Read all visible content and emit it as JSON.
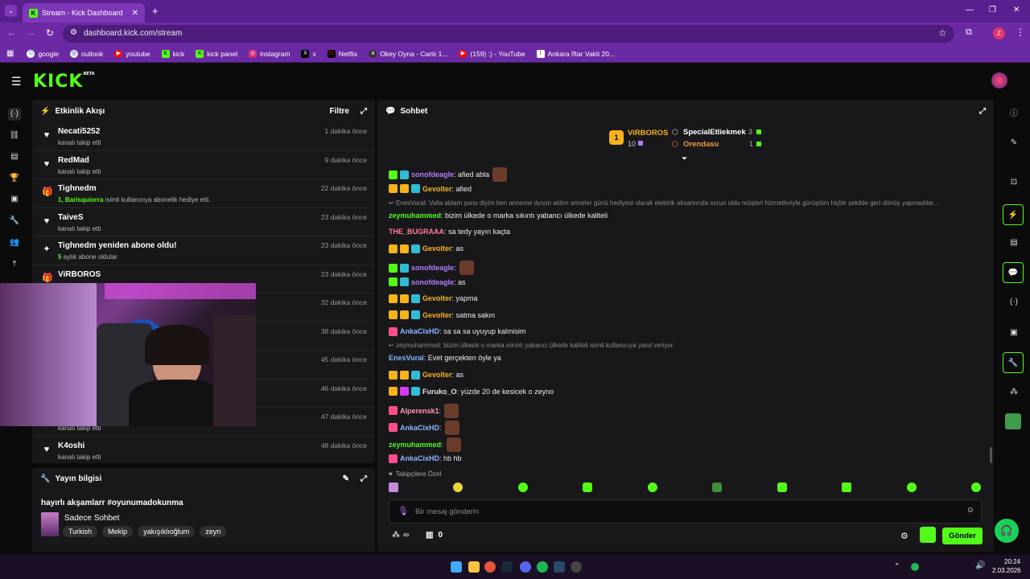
{
  "browser": {
    "tab_title": "Stream - Kick Dashboard",
    "url": "dashboard.kick.com/stream",
    "profile_initial": "Z",
    "bookmarks": [
      "google",
      "outlook",
      "youtube",
      "kick",
      "kick panel",
      "instagram",
      "x",
      "Netflix",
      "Okey Oyna - Canlı 1...",
      "(159) :) - YouTube",
      "Ankara İftar Vakti 20..."
    ]
  },
  "app": {
    "logo": "KICK",
    "logo_badge": "BETA"
  },
  "activity": {
    "title": "Etkinlik Akışı",
    "filter_label": "Filtre",
    "events": [
      {
        "name": "Necati5252",
        "time": "1 dakika önce",
        "sub": "kanalı takip etti",
        "icon": "heart"
      },
      {
        "name": "RedMad",
        "time": "9 dakika önce",
        "sub": "kanalı takip etti",
        "icon": "heart"
      },
      {
        "name": "Tighnedm",
        "time": "22 dakika önce",
        "sub_strong": "1, Barisquiorra",
        "sub": " isimli kullanıcıya abonelik hediye etti.",
        "icon": "gift"
      },
      {
        "name": "TaiveS",
        "time": "23 dakika önce",
        "sub": "kanalı takip etti",
        "icon": "heart"
      },
      {
        "name": "Tighnedm yeniden abone oldu!",
        "time": "23 dakika önce",
        "sub_strong": "5",
        "sub": " aylık abone oldular",
        "icon": "sparkle"
      },
      {
        "name": "ViRBOROS",
        "time": "23 dakika önce",
        "sub": "kullanıcıya abonelik hediye etti.",
        "icon": "gift"
      },
      {
        "name": "",
        "time": "32 dakika önce",
        "sub": "",
        "icon": "heart"
      },
      {
        "name": "",
        "time": "38 dakika önce",
        "sub": "onelik hediye etti.",
        "icon": "gift"
      },
      {
        "name": "",
        "time": "45 dakika önce",
        "sub": "",
        "icon": "heart"
      },
      {
        "name": "",
        "time": "46 dakika önce",
        "sub": "",
        "icon": "heart"
      },
      {
        "name": "",
        "time": "47 dakika önce",
        "sub": "kanalı takip etti",
        "icon": "heart"
      },
      {
        "name": "K4oshi",
        "time": "48 dakika önce",
        "sub": "kanalı takip etti",
        "icon": "heart"
      }
    ]
  },
  "stream_info": {
    "title": "Yayın bilgisi",
    "stream_title": "hayırlı akşamlarr #oyunumadokunma",
    "category": "Sadece Sohbet",
    "tags": [
      "Turkish",
      "Mekip",
      "yakışıklıoğlum",
      "zeyn"
    ]
  },
  "chat": {
    "title": "Sohbet",
    "leaderboard": {
      "first": {
        "name": "ViRBOROS",
        "rank": "1",
        "count": "10"
      },
      "second": {
        "name": "SpecialEtliekmek",
        "count": "3"
      },
      "third": {
        "name": "Orendasu",
        "count": "1"
      }
    },
    "messages": [
      {
        "user": "sonofdeagle",
        "color": "#b37bff",
        "text": ": afied abla",
        "emote": true
      },
      {
        "user": "Gevolter",
        "color": "#f5b21a",
        "text": ": afied"
      },
      {
        "reply": "EnesVural: Valla ablam şunu diyim ben anneme dyson aldım anneler günü hediyesi olarak elektrik aksamında sorun oldu müşteri hizmetleriyle görüştüm hiçbir şekilde geri dönüş yapmadılar..."
      },
      {
        "user": "zeymuhammed",
        "color": "#53fc18",
        "text": ": bizim ülkede o marka sıkıntı yabancı ülkede kaliteli"
      },
      {
        "user": "THE_BUGRAAA",
        "color": "#ff7a9a",
        "text": ": sa tedy yayın kaçta"
      },
      {
        "user": "Gevolter",
        "color": "#f5b21a",
        "text": ": as"
      },
      {
        "user": "sonofdeagle",
        "color": "#b37bff",
        "text": ": ",
        "emote": true
      },
      {
        "user": "sonofdeagle",
        "color": "#b37bff",
        "text": ": as"
      },
      {
        "user": "Gevolter",
        "color": "#f5b21a",
        "text": ": yapma"
      },
      {
        "user": "Gevolter",
        "color": "#f5b21a",
        "text": ": satma sakın"
      },
      {
        "user": "AnkaCixHD",
        "color": "#8ab4ff",
        "text": ": sa sa sa uyuyup kalmisim"
      },
      {
        "reply": "zeymuhammed: bizim ülkede o marka sıkıntı yabancı ülkede kaliteli isimli kullanıcıya yanıt veriyor"
      },
      {
        "user": "EnesVural",
        "color": "#7ab8ff",
        "text": ": Evet gerçekten öyle ya"
      },
      {
        "user": "Gevolter",
        "color": "#f5b21a",
        "text": ": as"
      },
      {
        "user": "Furuko_O",
        "color": "#e0e0e0",
        "text": ": yüzde 20 de kesicek o zeyno"
      },
      {
        "user": "Alperensk1",
        "color": "#ff9aa8",
        "text": ": ",
        "emote": true
      },
      {
        "user": "AnkaCixHD",
        "color": "#8ab4ff",
        "text": ": ",
        "emote": true
      },
      {
        "user": "zeymuhammed",
        "color": "#53fc18",
        "text": ": ",
        "emote": true
      },
      {
        "user": "AnkaCixHD",
        "color": "#8ab4ff",
        "text": ": hb hb"
      }
    ],
    "follower_label": "Takipçilere Özel",
    "input_placeholder": "Bir mesaj gönderin",
    "points": "∞",
    "store_count": "0",
    "send_label": "Gönder"
  },
  "taskbar": {
    "time": "20:24",
    "date": "2.03.2026"
  },
  "colors": {
    "accent": "#53fc18",
    "browser": "#6b2aa3"
  }
}
